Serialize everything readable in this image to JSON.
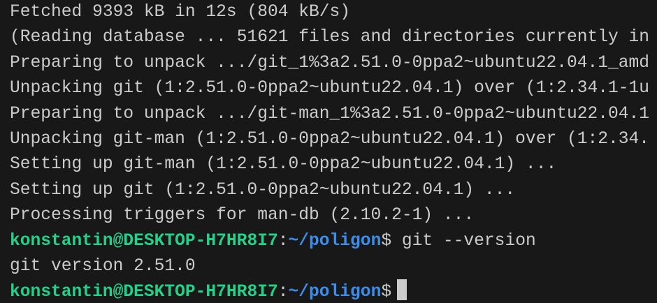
{
  "terminal": {
    "output_lines": [
      "Fetched 9393 kB in 12s (804 kB/s)",
      "(Reading database ... 51621 files and directories currently in",
      "Preparing to unpack .../git_1%3a2.51.0-0ppa2~ubuntu22.04.1_amd",
      "Unpacking git (1:2.51.0-0ppa2~ubuntu22.04.1) over (1:2.34.1-1u",
      "Preparing to unpack .../git-man_1%3a2.51.0-0ppa2~ubuntu22.04.1",
      "Unpacking git-man (1:2.51.0-0ppa2~ubuntu22.04.1) over (1:2.34.",
      "Setting up git-man (1:2.51.0-0ppa2~ubuntu22.04.1) ...",
      "Setting up git (1:2.51.0-0ppa2~ubuntu22.04.1) ...",
      "Processing triggers for man-db (2.10.2-1) ..."
    ],
    "prompt": {
      "user_host": "konstantin@DESKTOP-H7HR8I7",
      "sep": ":",
      "path": "~/poligon",
      "symbol": "$"
    },
    "command": " git --version",
    "command_output": "git version 2.51.0",
    "colors": {
      "background": "#181818",
      "text": "#cccccc",
      "user": "#23d18b",
      "path": "#3b8eea"
    }
  }
}
